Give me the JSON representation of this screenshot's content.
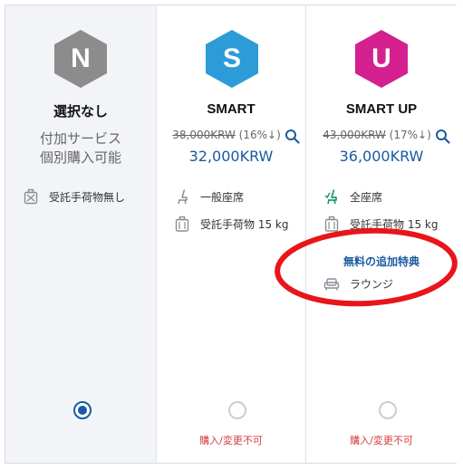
{
  "options": [
    {
      "letter": "N",
      "badge_color": "#8c8c8c",
      "title": "選択なし",
      "note_line1": "付加サービス",
      "note_line2": "個別購入可能",
      "features": [
        {
          "icon": "no-baggage-icon",
          "label": "受託手荷物無し"
        }
      ],
      "selected": true
    },
    {
      "letter": "S",
      "badge_color": "#2d9bd8",
      "title": "SMART",
      "original_price": "38,000KRW",
      "discount": "(16%↓)",
      "price": "32,000KRW",
      "features": [
        {
          "icon": "standard-seat-icon",
          "label": "一般座席"
        },
        {
          "icon": "baggage-icon",
          "label": "受託手荷物 15 kg"
        }
      ],
      "status": "購入/変更不可",
      "selected": false
    },
    {
      "letter": "U",
      "badge_color": "#d4218f",
      "title": "SMART UP",
      "original_price": "43,000KRW",
      "discount": "(17%↓)",
      "price": "36,000KRW",
      "features": [
        {
          "icon": "all-seats-icon",
          "label": "全座席"
        },
        {
          "icon": "baggage-icon",
          "label": "受託手荷物 15 kg"
        }
      ],
      "bonus_heading": "無料の追加特典",
      "bonus": [
        {
          "icon": "lounge-icon",
          "label": "ラウンジ"
        }
      ],
      "status": "購入/変更不可",
      "selected": false
    }
  ],
  "colors": {
    "accent_blue": "#1a5aa0",
    "unavailable_red": "#d63b3b",
    "highlight_ring": "#e8151b",
    "selected_column_bg": "#f2f4f7"
  }
}
